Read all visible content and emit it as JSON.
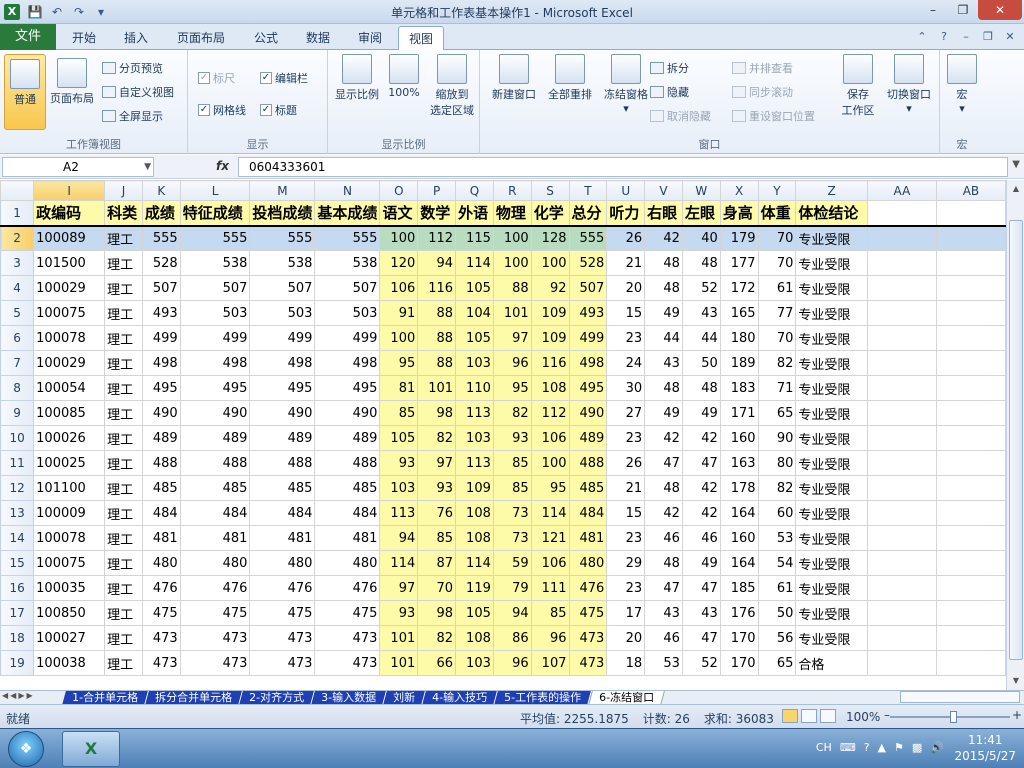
{
  "window": {
    "title": "单元格和工作表基本操作1 - Microsoft Excel",
    "app_icon": "X"
  },
  "ribbon_tabs": {
    "file": "文件",
    "items": [
      "开始",
      "插入",
      "页面布局",
      "公式",
      "数据",
      "审阅",
      "视图"
    ],
    "active": "视图"
  },
  "ribbon": {
    "workbook_views": {
      "normal": "普通",
      "page_layout": "页面布局",
      "page_break": "分页预览",
      "custom": "自定义视图",
      "fullscreen": "全屏显示",
      "label": "工作簿视图"
    },
    "show": {
      "ruler": "标尺",
      "formula_bar": "编辑栏",
      "gridlines": "网格线",
      "headings": "标题",
      "label": "显示"
    },
    "zoom": {
      "zoom": "显示比例",
      "hundred": "100%",
      "to_selection_1": "缩放到",
      "to_selection_2": "选定区域",
      "label": "显示比例"
    },
    "window": {
      "new_window": "新建窗口",
      "arrange_all": "全部重排",
      "freeze_panes": "冻结窗格",
      "split": "拆分",
      "hide": "隐藏",
      "unhide": "取消隐藏",
      "side_by_side": "并排查看",
      "sync_scroll": "同步滚动",
      "reset_pos": "重设窗口位置",
      "save_ws_1": "保存",
      "save_ws_2": "工作区",
      "switch_win": "切换窗口",
      "label": "窗口"
    },
    "macros": {
      "macro": "宏",
      "label": "宏"
    }
  },
  "formula_bar": {
    "name_box": "A2",
    "fx": "fx",
    "value": "0604333601"
  },
  "columns": [
    "I",
    "J",
    "K",
    "L",
    "M",
    "N",
    "O",
    "P",
    "Q",
    "R",
    "S",
    "T",
    "U",
    "V",
    "W",
    "X",
    "Y",
    "Z",
    "AA",
    "AB"
  ],
  "headers": [
    "政编码",
    "科类",
    "成绩",
    "特征成绩",
    "投档成绩",
    "基本成绩",
    "语文",
    "数学",
    "外语",
    "物理",
    "化学",
    "总分",
    "听力",
    "右眼",
    "左眼",
    "身高",
    "体重",
    "体检结论"
  ],
  "rows": [
    [
      "100089",
      "理工",
      "555",
      "555",
      "555",
      "555",
      "100",
      "112",
      "115",
      "100",
      "128",
      "555",
      "26",
      "42",
      "40",
      "179",
      "70",
      "专业受限"
    ],
    [
      "101500",
      "理工",
      "528",
      "538",
      "538",
      "538",
      "120",
      "94",
      "114",
      "100",
      "100",
      "528",
      "21",
      "48",
      "48",
      "177",
      "70",
      "专业受限"
    ],
    [
      "100029",
      "理工",
      "507",
      "507",
      "507",
      "507",
      "106",
      "116",
      "105",
      "88",
      "92",
      "507",
      "20",
      "48",
      "52",
      "172",
      "61",
      "专业受限"
    ],
    [
      "100075",
      "理工",
      "493",
      "503",
      "503",
      "503",
      "91",
      "88",
      "104",
      "101",
      "109",
      "493",
      "15",
      "49",
      "43",
      "165",
      "77",
      "专业受限"
    ],
    [
      "100078",
      "理工",
      "499",
      "499",
      "499",
      "499",
      "100",
      "88",
      "105",
      "97",
      "109",
      "499",
      "23",
      "44",
      "44",
      "180",
      "70",
      "专业受限"
    ],
    [
      "100029",
      "理工",
      "498",
      "498",
      "498",
      "498",
      "95",
      "88",
      "103",
      "96",
      "116",
      "498",
      "24",
      "43",
      "50",
      "189",
      "82",
      "专业受限"
    ],
    [
      "100054",
      "理工",
      "495",
      "495",
      "495",
      "495",
      "81",
      "101",
      "110",
      "95",
      "108",
      "495",
      "30",
      "48",
      "48",
      "183",
      "71",
      "专业受限"
    ],
    [
      "100085",
      "理工",
      "490",
      "490",
      "490",
      "490",
      "85",
      "98",
      "113",
      "82",
      "112",
      "490",
      "27",
      "49",
      "49",
      "171",
      "65",
      "专业受限"
    ],
    [
      "100026",
      "理工",
      "489",
      "489",
      "489",
      "489",
      "105",
      "82",
      "103",
      "93",
      "106",
      "489",
      "23",
      "42",
      "42",
      "160",
      "90",
      "专业受限"
    ],
    [
      "100025",
      "理工",
      "488",
      "488",
      "488",
      "488",
      "93",
      "97",
      "113",
      "85",
      "100",
      "488",
      "26",
      "47",
      "47",
      "163",
      "80",
      "专业受限"
    ],
    [
      "101100",
      "理工",
      "485",
      "485",
      "485",
      "485",
      "103",
      "93",
      "109",
      "85",
      "95",
      "485",
      "21",
      "48",
      "42",
      "178",
      "82",
      "专业受限"
    ],
    [
      "100009",
      "理工",
      "484",
      "484",
      "484",
      "484",
      "113",
      "76",
      "108",
      "73",
      "114",
      "484",
      "15",
      "42",
      "42",
      "164",
      "60",
      "专业受限"
    ],
    [
      "100078",
      "理工",
      "481",
      "481",
      "481",
      "481",
      "94",
      "85",
      "108",
      "73",
      "121",
      "481",
      "23",
      "46",
      "46",
      "160",
      "53",
      "专业受限"
    ],
    [
      "100075",
      "理工",
      "480",
      "480",
      "480",
      "480",
      "114",
      "87",
      "114",
      "59",
      "106",
      "480",
      "29",
      "48",
      "49",
      "164",
      "54",
      "专业受限"
    ],
    [
      "100035",
      "理工",
      "476",
      "476",
      "476",
      "476",
      "97",
      "70",
      "119",
      "79",
      "111",
      "476",
      "23",
      "47",
      "47",
      "185",
      "61",
      "专业受限"
    ],
    [
      "100850",
      "理工",
      "475",
      "475",
      "475",
      "475",
      "93",
      "98",
      "105",
      "94",
      "85",
      "475",
      "17",
      "43",
      "43",
      "176",
      "50",
      "专业受限"
    ],
    [
      "100027",
      "理工",
      "473",
      "473",
      "473",
      "473",
      "101",
      "82",
      "108",
      "86",
      "96",
      "473",
      "20",
      "46",
      "47",
      "170",
      "56",
      "专业受限"
    ],
    [
      "100038",
      "理工",
      "473",
      "473",
      "473",
      "473",
      "101",
      "66",
      "103",
      "96",
      "107",
      "473",
      "18",
      "53",
      "52",
      "170",
      "65",
      "合格"
    ]
  ],
  "sheet_tabs": [
    "1-合并单元格",
    "拆分合并单元格",
    "2-对齐方式",
    "3-输入数据",
    "刘新",
    "4-输入技巧",
    "5-工作表的操作",
    "6-冻结窗口"
  ],
  "active_sheet": "6-冻结窗口",
  "status": {
    "ready": "就绪",
    "average": "平均值: 2255.1875",
    "count": "计数: 26",
    "sum": "求和: 36083",
    "zoom": "100%"
  },
  "taskbar": {
    "lang": "CH",
    "time": "11:41",
    "date": "2015/5/27"
  }
}
